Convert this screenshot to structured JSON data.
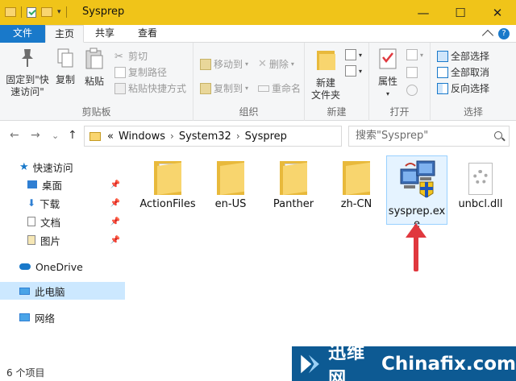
{
  "window": {
    "title": "Sysprep",
    "minimize_glyph": "—",
    "maximize_glyph": "☐",
    "close_glyph": "✕"
  },
  "quick_access_toolbar": {
    "icons": [
      "folder-icon",
      "properties-check-icon",
      "new-folder-icon",
      "customize-dropdown-icon"
    ]
  },
  "ribbon_tabs": {
    "file": "文件",
    "home": "主页",
    "share": "共享",
    "view": "查看",
    "help_glyph": "?"
  },
  "ribbon": {
    "clipboard": {
      "label": "剪贴板",
      "pin_to_quick_access": "固定到\"快速访问\"",
      "copy": "复制",
      "paste": "粘贴",
      "cut": "剪切",
      "copy_path": "复制路径",
      "paste_shortcut": "粘贴快捷方式"
    },
    "organize": {
      "label": "组织",
      "move_to": "移动到",
      "copy_to": "复制到",
      "delete": "删除",
      "rename": "重命名"
    },
    "new": {
      "label": "新建",
      "new_folder": "新建\n文件夹"
    },
    "open": {
      "label": "打开",
      "properties": "属性"
    },
    "select": {
      "label": "选择",
      "select_all": "全部选择",
      "select_none": "全部取消",
      "invert_selection": "反向选择"
    }
  },
  "navigation": {
    "back_glyph": "←",
    "forward_glyph": "→",
    "recent_glyph": "⌄",
    "up_glyph": "↑",
    "address_overflow": "«",
    "breadcrumbs": [
      "Windows",
      "System32",
      "Sysprep"
    ],
    "crumb_separator": "›",
    "refresh_glyph": "↻",
    "search_placeholder": "搜索\"Sysprep\""
  },
  "nav_pane": {
    "quick_access": "快速访问",
    "items": [
      {
        "label": "桌面",
        "icon": "desktop-icon",
        "pinned": true
      },
      {
        "label": "下载",
        "icon": "downloads-icon",
        "pinned": true
      },
      {
        "label": "文档",
        "icon": "documents-icon",
        "pinned": true
      },
      {
        "label": "图片",
        "icon": "pictures-icon",
        "pinned": true
      }
    ],
    "pin_glyph": "📌",
    "onedrive": "OneDrive",
    "this_pc": "此电脑",
    "network": "网络"
  },
  "files": [
    {
      "name": "ActionFiles",
      "type": "folder"
    },
    {
      "name": "en-US",
      "type": "folder"
    },
    {
      "name": "Panther",
      "type": "folder"
    },
    {
      "name": "zh-CN",
      "type": "folder"
    },
    {
      "name": "sysprep.exe",
      "type": "application",
      "selected": true
    },
    {
      "name": "unbcl.dll",
      "type": "dll"
    }
  ],
  "status": {
    "item_count": "6 个项目"
  },
  "watermark": {
    "cn": "迅维网",
    "en": "Chinafix.com"
  },
  "colors": {
    "titlebar": "#f0c419",
    "file_tab": "#1979ca",
    "selection": "#cce8ff",
    "arrow": "#e0383e",
    "watermark_bg": "#0d5a93"
  }
}
